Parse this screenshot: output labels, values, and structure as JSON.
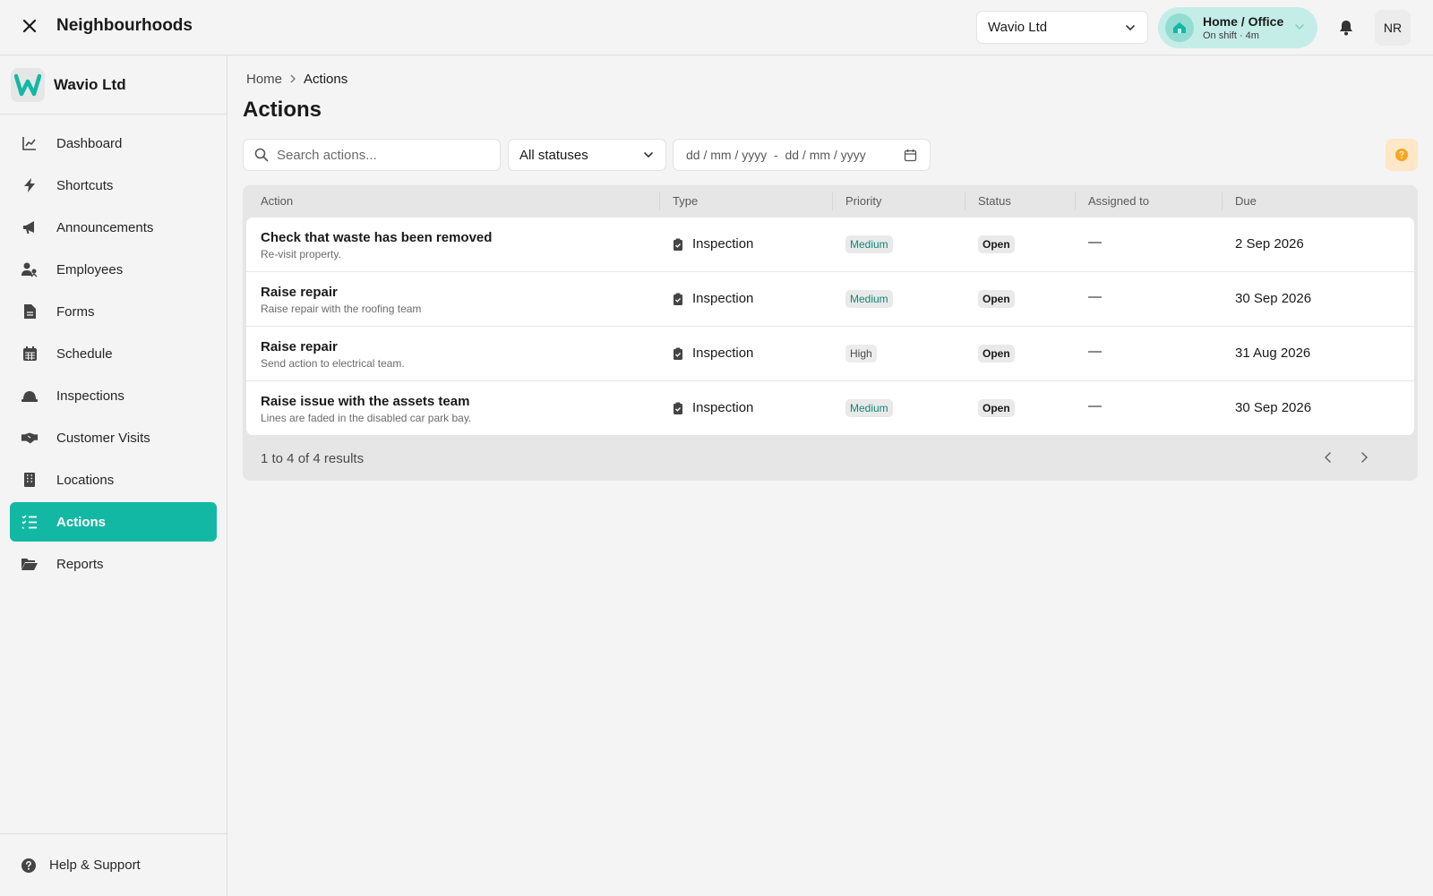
{
  "header": {
    "close_icon": "close-icon",
    "title": "Neighbourhoods",
    "org_select": "Wavio Ltd",
    "shift": {
      "title": "Home / Office",
      "subtitle": "On shift · 4m"
    },
    "user_initials": "NR",
    "accent": "#13b8a5"
  },
  "sidebar": {
    "org_name": "Wavio Ltd",
    "org_logo_letter": "W",
    "items": [
      {
        "label": "Dashboard",
        "icon": "chart-line-icon"
      },
      {
        "label": "Shortcuts",
        "icon": "bolt-icon"
      },
      {
        "label": "Announcements",
        "icon": "megaphone-icon"
      },
      {
        "label": "Employees",
        "icon": "users-icon"
      },
      {
        "label": "Forms",
        "icon": "document-icon"
      },
      {
        "label": "Schedule",
        "icon": "calendar-icon"
      },
      {
        "label": "Inspections",
        "icon": "hard-hat-icon"
      },
      {
        "label": "Customer Visits",
        "icon": "handshake-icon"
      },
      {
        "label": "Locations",
        "icon": "building-icon"
      },
      {
        "label": "Actions",
        "icon": "list-check-icon",
        "active": true
      },
      {
        "label": "Reports",
        "icon": "folder-open-icon"
      }
    ],
    "help_label": "Help & Support"
  },
  "main": {
    "breadcrumb": {
      "home": "Home",
      "current": "Actions"
    },
    "title": "Actions",
    "search_placeholder": "Search actions...",
    "status_filter": "All statuses",
    "date_range": {
      "from": "dd / mm / yyyy",
      "sep": "-",
      "to": "dd / mm / yyyy"
    },
    "table": {
      "columns": [
        "Action",
        "Type",
        "Priority",
        "Status",
        "Assigned to",
        "Due"
      ],
      "rows": [
        {
          "title": "Check that waste has been removed",
          "subtitle": "Re-visit property.",
          "type": "Inspection",
          "priority": "Medium",
          "status": "Open",
          "assigned": "—",
          "due": "2 Sep 2026"
        },
        {
          "title": "Raise repair",
          "subtitle": "Raise repair with the roofing team",
          "type": "Inspection",
          "priority": "Medium",
          "status": "Open",
          "assigned": "—",
          "due": "30 Sep 2026"
        },
        {
          "title": "Raise repair",
          "subtitle": "Send action to electrical team.",
          "type": "Inspection",
          "priority": "High",
          "status": "Open",
          "assigned": "—",
          "due": "31 Aug 2026"
        },
        {
          "title": "Raise issue with the assets team",
          "subtitle": "Lines are faded in the disabled car park bay.",
          "type": "Inspection",
          "priority": "Medium",
          "status": "Open",
          "assigned": "—",
          "due": "30 Sep 2026"
        }
      ],
      "results_text": "1 to 4 of 4 results"
    }
  }
}
